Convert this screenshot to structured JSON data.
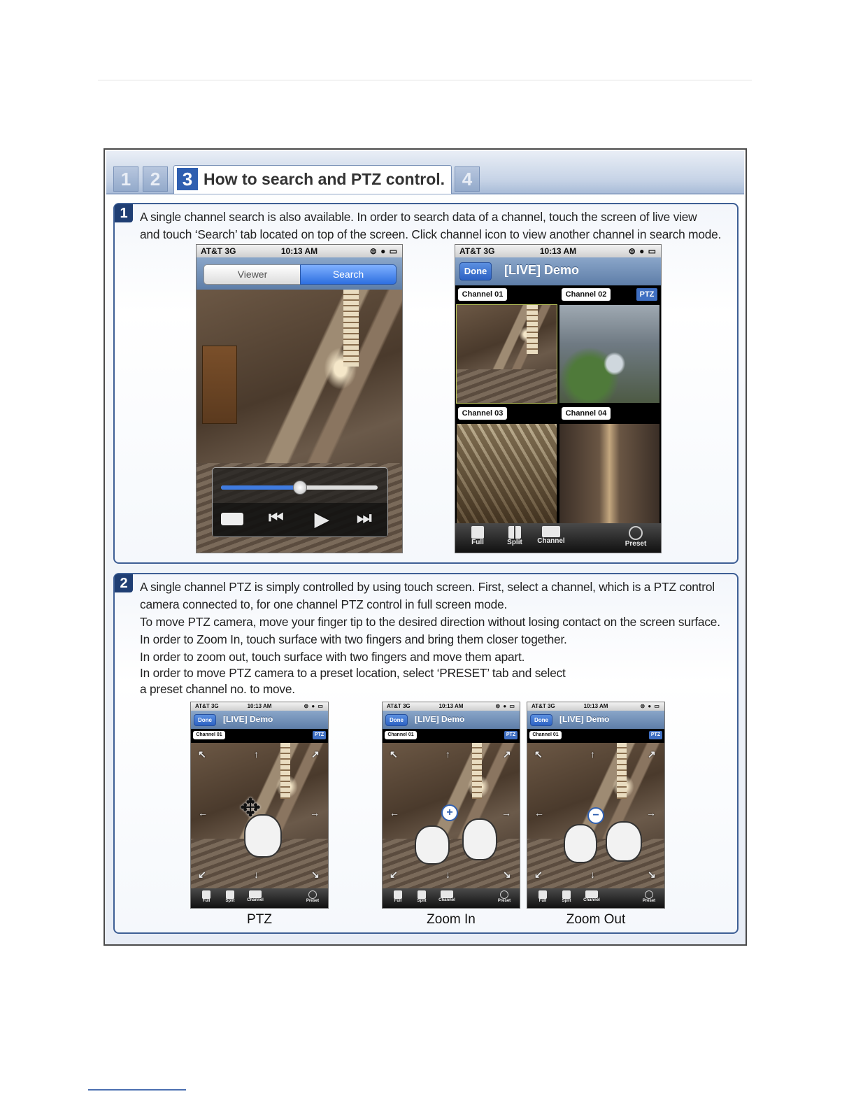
{
  "tabs": {
    "tab1": "1",
    "tab2": "2",
    "tab3": "3",
    "tab4": "4",
    "active_title": "How to search and PTZ control."
  },
  "section1": {
    "num": "1",
    "lines": [
      "A single channel search is also available.  In order to search data of a channel, touch the screen of live view",
      "and touch ‘Search’ tab located on top of the screen. Click channel icon to view another channel in search mode."
    ]
  },
  "section2": {
    "num": "2",
    "lines": [
      "A single channel PTZ is simply  controlled by using touch screen. First, select a channel, which is a PTZ control",
      "camera connected to, for one channel PTZ control in full screen mode.",
      "To move PTZ camera, move your finger tip to the desired direction without losing contact on the screen surface.",
      "In order to Zoom In, touch surface with two fingers and bring them closer together.",
      "In order to zoom out, touch surface with two fingers and move them apart.",
      "In order to move PTZ camera to a preset location, select ‘PRESET’ tab and select",
      "a preset channel no. to move."
    ]
  },
  "status": {
    "carrier": "AT&T  3G",
    "time": "10:13 AM",
    "icons": "⊜ ● ▭"
  },
  "search_phone": {
    "viewer_tab": "Viewer",
    "search_tab": "Search",
    "slider_value": 0.5
  },
  "live_phone": {
    "done": "Done",
    "title": "[LIVE] Demo",
    "channels": [
      "Channel 01",
      "Channel 02",
      "Channel 03",
      "Channel 04"
    ],
    "ptz": "PTZ"
  },
  "toolbar": {
    "full": "Full",
    "split": "Split",
    "channel": "Channel",
    "preset": "Preset"
  },
  "small_phone": {
    "done": "Done",
    "title": "[LIVE] Demo",
    "channel": "Channel 01",
    "ptz": "PTZ"
  },
  "captions": {
    "ptz": "PTZ",
    "zoom_in": "Zoom In",
    "zoom_out": "Zoom Out"
  },
  "colors": {
    "accent": "#2f5fb0",
    "section_border": "#3e5f95",
    "badge": "#1f3e73"
  }
}
